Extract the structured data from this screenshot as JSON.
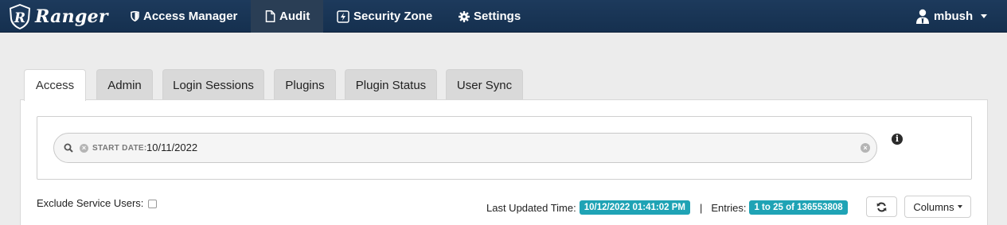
{
  "navbar": {
    "brand": "Ranger",
    "items": [
      {
        "label": "Access Manager",
        "icon": "shield-icon"
      },
      {
        "label": "Audit",
        "icon": "file-icon"
      },
      {
        "label": "Security Zone",
        "icon": "zone-icon"
      },
      {
        "label": "Settings",
        "icon": "gear-icon"
      }
    ],
    "active": "Audit",
    "user": "mbush"
  },
  "tabs": [
    {
      "label": "Access"
    },
    {
      "label": "Admin"
    },
    {
      "label": "Login Sessions"
    },
    {
      "label": "Plugins"
    },
    {
      "label": "Plugin Status"
    },
    {
      "label": "User Sync"
    }
  ],
  "active_tab": "Access",
  "search": {
    "facet_category": "START DATE:",
    "facet_value": "10/11/2022"
  },
  "filters": {
    "exclude_label": "Exclude Service Users:",
    "exclude_checked": false
  },
  "status": {
    "last_updated_label": "Last Updated Time:",
    "last_updated_value": "10/12/2022 01:41:02 PM",
    "separator": "|",
    "entries_label": "Entries:",
    "entries_value": "1 to 25 of 136553808"
  },
  "columns_label": "Columns",
  "colors": {
    "navbar": "#15304f",
    "badge": "#1fa3b5",
    "background": "#ececec"
  }
}
